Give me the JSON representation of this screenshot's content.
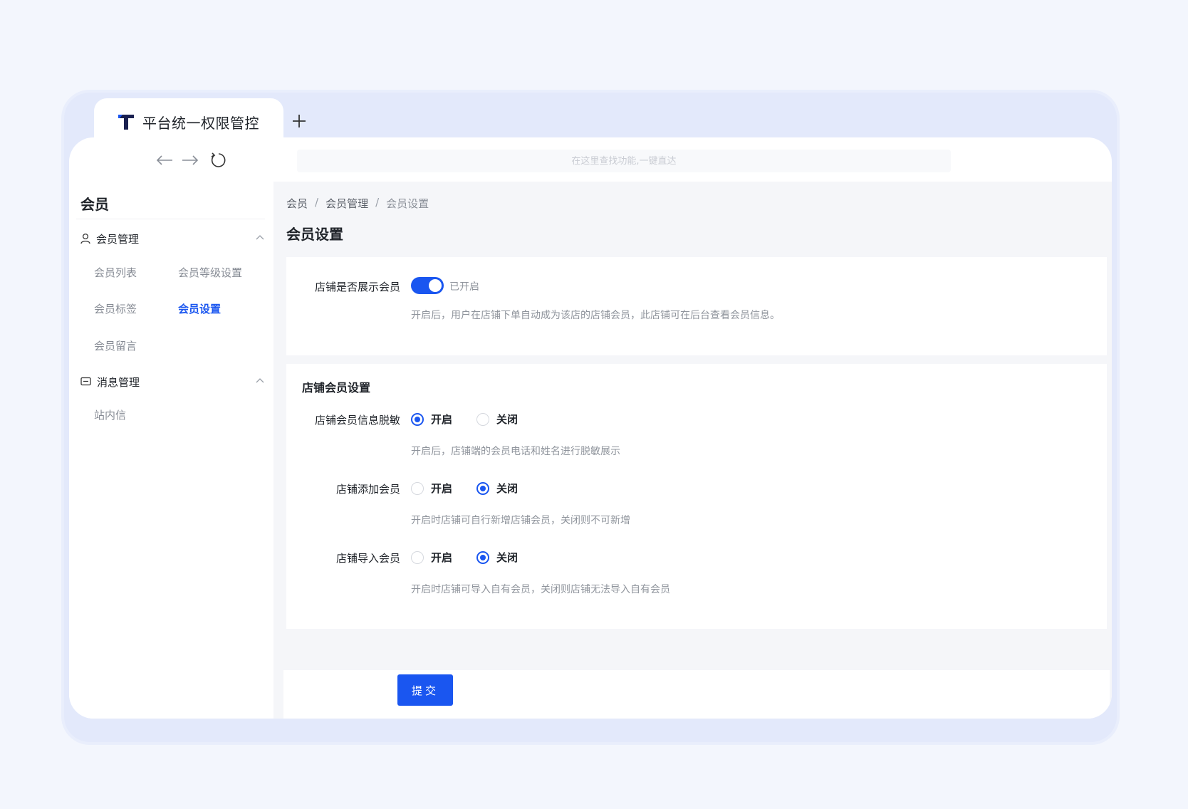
{
  "browser": {
    "tab_title": "平台统一权限管控",
    "search_placeholder": "在这里查找功能,一键直达"
  },
  "sidebar": {
    "title": "会员",
    "groups": [
      {
        "label": "会员管理",
        "icon": "user-icon",
        "items": [
          "会员列表",
          "会员等级设置",
          "会员标签",
          "会员设置",
          "会员留言"
        ],
        "active": "会员设置"
      },
      {
        "label": "消息管理",
        "icon": "message-icon",
        "items": [
          "站内信"
        ]
      }
    ]
  },
  "breadcrumb": [
    "会员",
    "会员管理",
    "会员设置"
  ],
  "page_title": "会员设置",
  "display_setting": {
    "label": "店铺是否展示会员",
    "enabled": true,
    "status": "已开启",
    "hint": "开启后，用户在店铺下单自动成为该店的店铺会员，此店铺可在后台查看会员信息。"
  },
  "store_settings": {
    "title": "店铺会员设置",
    "fields": [
      {
        "label": "店铺会员信息脱敏",
        "options": [
          "开启",
          "关闭"
        ],
        "selected": "开启",
        "hint": "开启后，店铺端的会员电话和姓名进行脱敏展示"
      },
      {
        "label": "店铺添加会员",
        "options": [
          "开启",
          "关闭"
        ],
        "selected": "关闭",
        "hint": "开启时店铺可自行新增店铺会员，关闭则不可新增"
      },
      {
        "label": "店铺导入会员",
        "options": [
          "开启",
          "关闭"
        ],
        "selected": "关闭",
        "hint": "开启时店铺可导入自有会员，关闭则店铺无法导入自有会员"
      }
    ]
  },
  "submit_label": "提交",
  "colors": {
    "primary": "#1a56f0",
    "background": "#f3f6fd",
    "window_frame": "#e3e9fb"
  }
}
